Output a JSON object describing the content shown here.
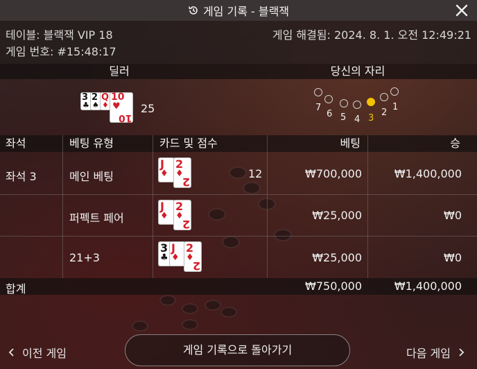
{
  "title": "게임 기록 - 블랙잭",
  "info": {
    "table": "테이블: 블랙잭 VIP 18",
    "game_no": "게임 번호: #15:48:17",
    "settled": "게임 해결됨: 2024. 8. 1. 오전 12:49:21"
  },
  "dealer": {
    "label": "딜러",
    "score": "25",
    "cards": [
      {
        "rank": "3",
        "suit": "♣",
        "color": "black"
      },
      {
        "rank": "2",
        "suit": "♠",
        "color": "black"
      },
      {
        "rank": "Q",
        "suit": "♦",
        "color": "red"
      },
      {
        "rank": "10",
        "suit": "♥",
        "color": "red"
      }
    ]
  },
  "seat_panel": {
    "label": "당신의 자리",
    "seats": [
      "7",
      "6",
      "5",
      "4",
      "3",
      "2",
      "1"
    ],
    "active_seat": "3"
  },
  "table": {
    "headers": {
      "seat": "좌석",
      "bet_type": "베팅 유형",
      "cards_score": "카드 및 점수",
      "bet": "베팅",
      "win": "승"
    },
    "rows": [
      {
        "seat": "좌석 3",
        "bet_type": "메인 베팅",
        "score": "12",
        "bet": "₩700,000",
        "win": "₩1,400,000",
        "cards": [
          {
            "rank": "J",
            "suit": "♦",
            "color": "red"
          },
          {
            "rank": "2",
            "suit": "♦",
            "color": "red"
          }
        ]
      },
      {
        "seat": "",
        "bet_type": "퍼펙트 페어",
        "score": "",
        "bet": "₩25,000",
        "win": "₩0",
        "cards": [
          {
            "rank": "J",
            "suit": "♦",
            "color": "red"
          },
          {
            "rank": "2",
            "suit": "♦",
            "color": "red"
          }
        ]
      },
      {
        "seat": "",
        "bet_type": "21+3",
        "score": "",
        "bet": "₩25,000",
        "win": "₩0",
        "cards": [
          {
            "rank": "3",
            "suit": "♣",
            "color": "black"
          },
          {
            "rank": "J",
            "suit": "♦",
            "color": "red"
          },
          {
            "rank": "2",
            "suit": "♦",
            "color": "red"
          }
        ]
      }
    ],
    "total": {
      "label": "합계",
      "bet": "₩750,000",
      "win": "₩1,400,000"
    }
  },
  "footer": {
    "prev": "이전 게임",
    "back": "게임 기록으로 돌아가기",
    "next": "다음 게임"
  },
  "colors": {
    "accent_yellow": "#f2c200",
    "card_red": "#d21f2b"
  },
  "icons": [
    "history-icon",
    "close-icon",
    "chevron-left-icon",
    "chevron-right-icon"
  ]
}
